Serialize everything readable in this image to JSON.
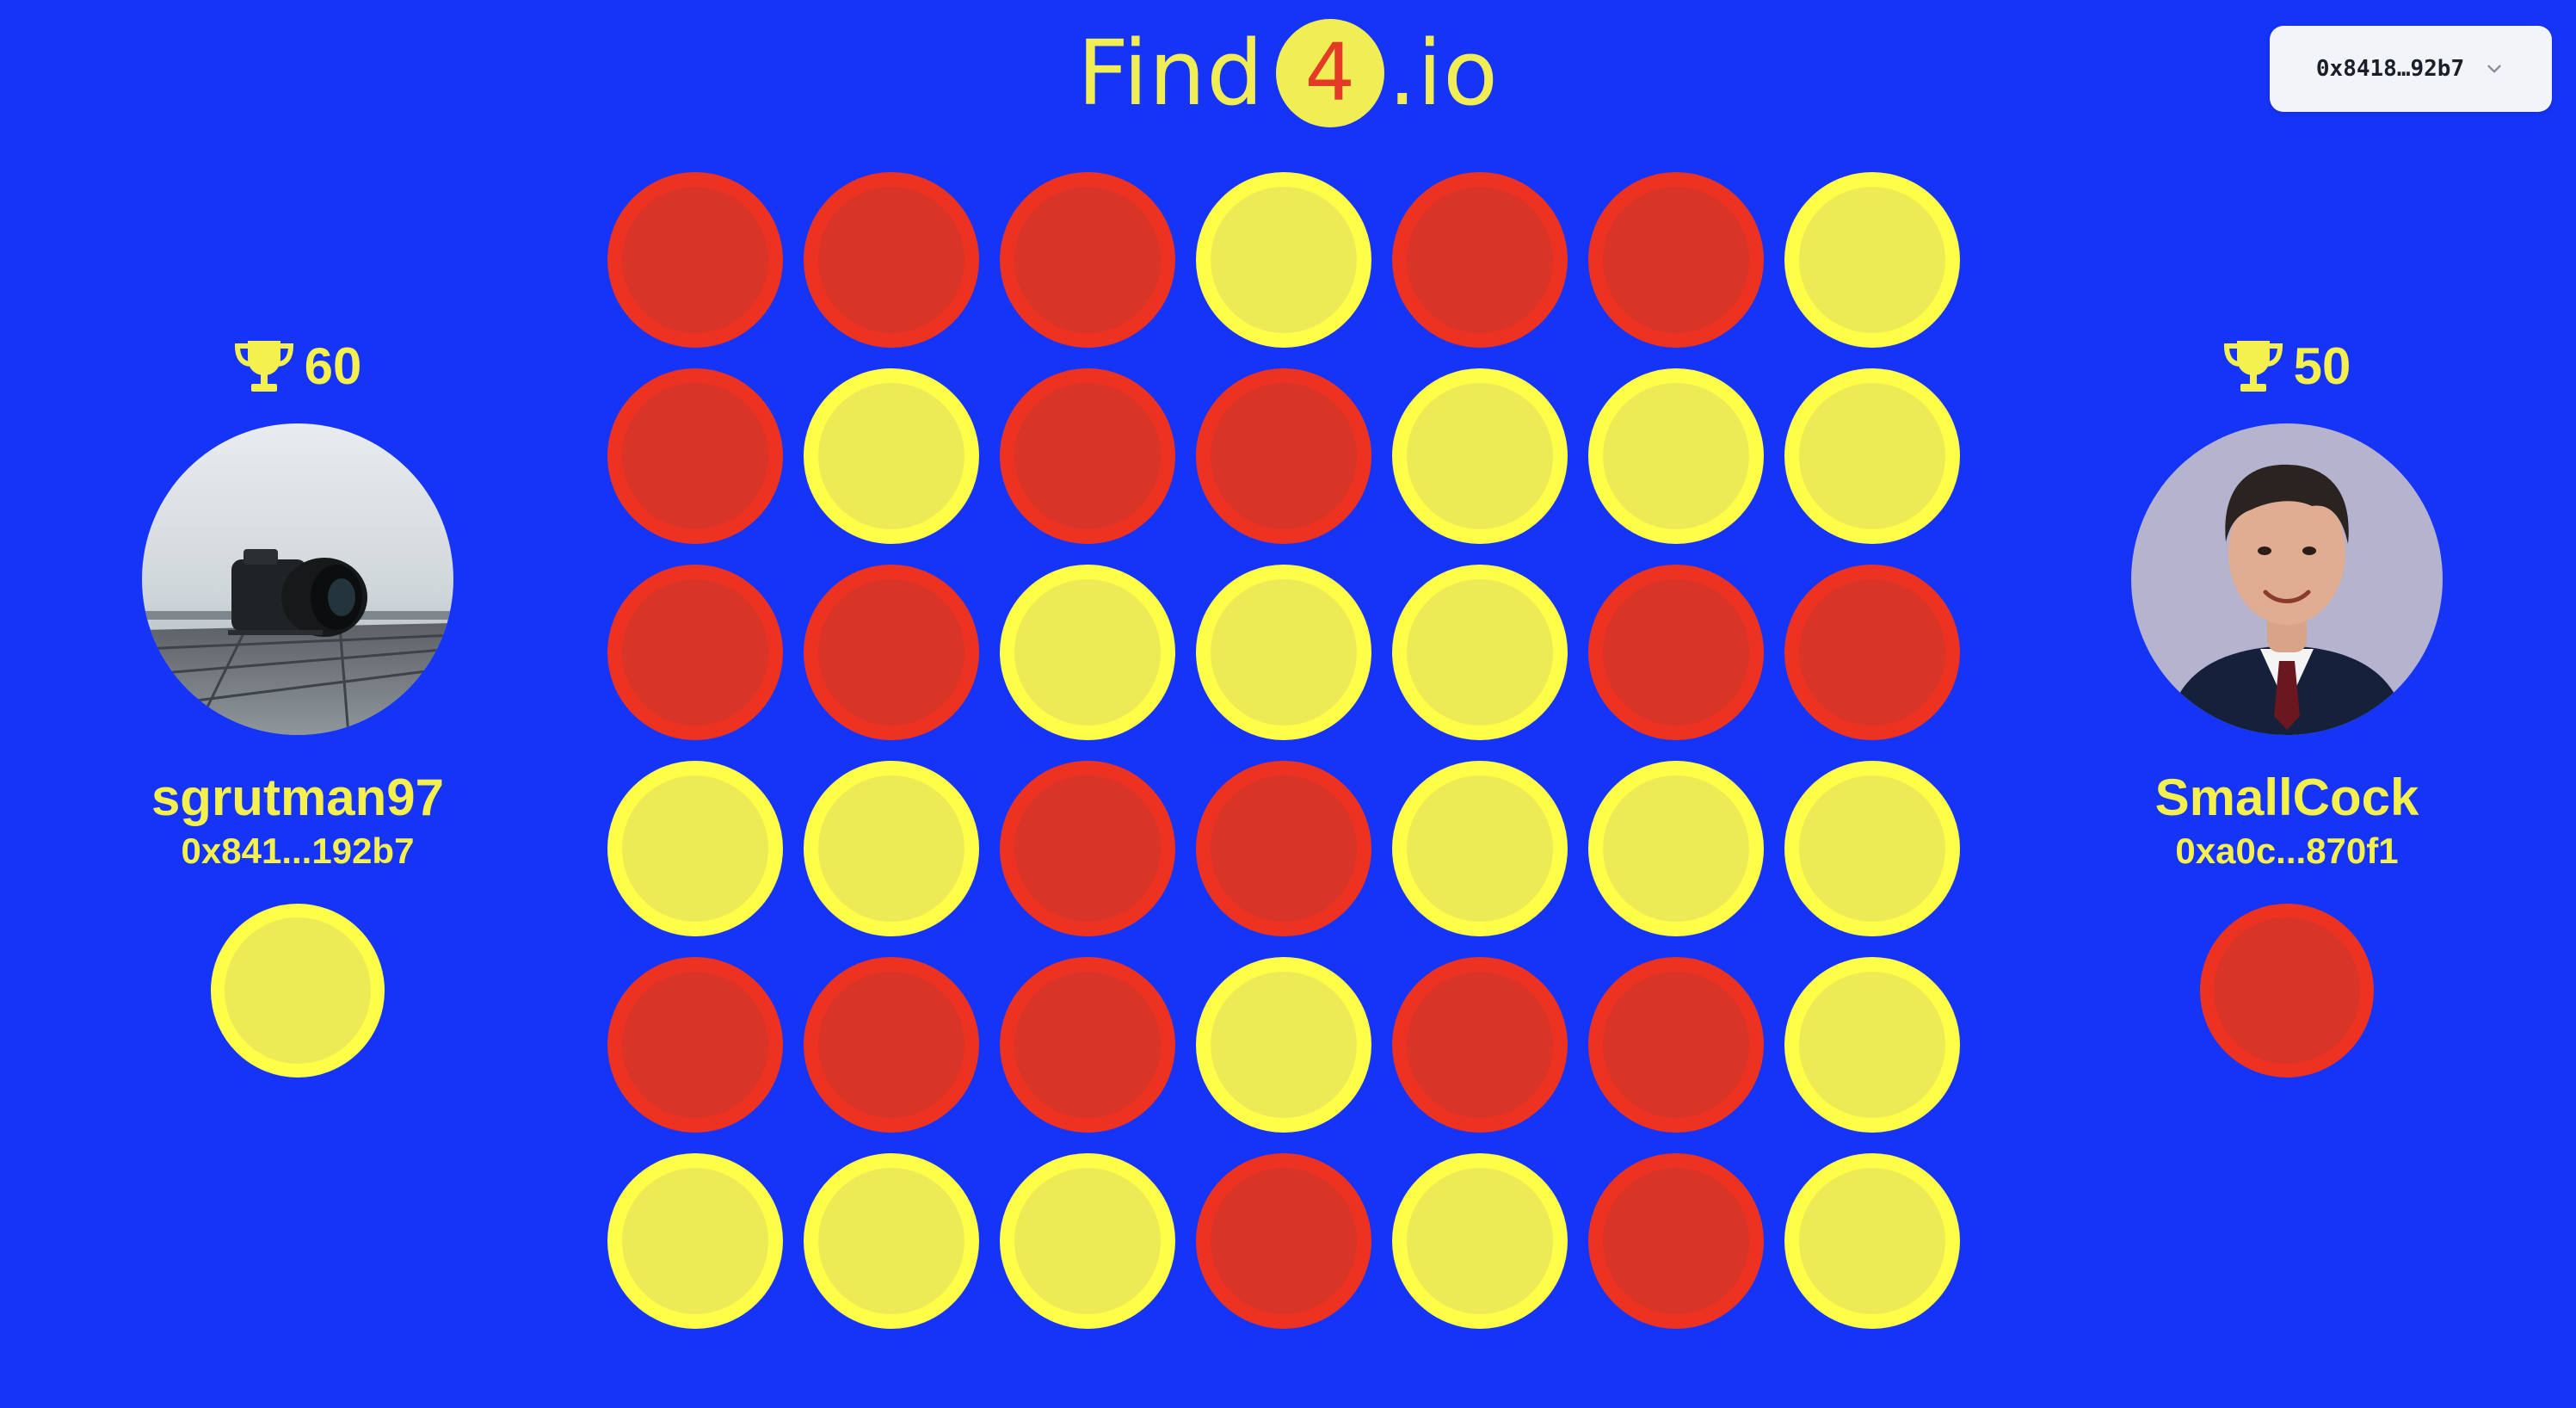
{
  "logo": {
    "prefix": "Find",
    "digit": "4",
    "suffix": ".io"
  },
  "wallet": {
    "address": "0x8418…92b7",
    "icon": "chevron-down-icon"
  },
  "colors": {
    "background": "#1534f6",
    "red_disc": "#d83428",
    "yellow_disc": "#eceb55",
    "accent_text": "#f4f04e"
  },
  "board": {
    "columns": 7,
    "rows": 6,
    "cells": [
      [
        "red",
        "red",
        "red",
        "yellow",
        "red",
        "red",
        "yellow"
      ],
      [
        "red",
        "yellow",
        "red",
        "red",
        "yellow",
        "yellow",
        "yellow"
      ],
      [
        "red",
        "red",
        "yellow",
        "yellow",
        "yellow",
        "red",
        "red"
      ],
      [
        "yellow",
        "yellow",
        "red",
        "red",
        "yellow",
        "yellow",
        "yellow"
      ],
      [
        "red",
        "red",
        "red",
        "yellow",
        "red",
        "red",
        "yellow"
      ],
      [
        "yellow",
        "yellow",
        "yellow",
        "red",
        "yellow",
        "red",
        "yellow"
      ]
    ]
  },
  "players": {
    "left": {
      "score": "60",
      "name": "sgrutman97",
      "address": "0x841...192b7",
      "disc_color": "yellow",
      "avatar": "camera-photo"
    },
    "right": {
      "score": "50",
      "name": "SmallCock",
      "address": "0xa0c...870f1",
      "disc_color": "red",
      "avatar": "man-in-suit-photo"
    }
  }
}
